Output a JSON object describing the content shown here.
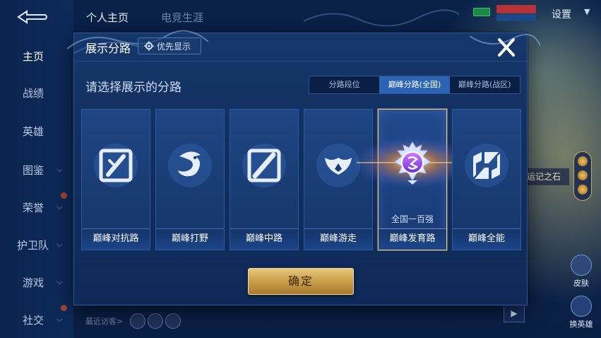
{
  "header": {
    "tabs": [
      {
        "label": "个人主页",
        "active": true
      },
      {
        "label": "电竞生涯",
        "active": false
      }
    ],
    "settings_label": "设置"
  },
  "left_nav": {
    "items": [
      {
        "label": "主页",
        "active": true,
        "has_chevron": false
      },
      {
        "label": "战绩",
        "active": false,
        "has_chevron": false
      },
      {
        "label": "英雄",
        "active": false,
        "has_chevron": false
      },
      {
        "label": "图鉴",
        "active": false,
        "has_chevron": true
      },
      {
        "label": "荣誉",
        "active": false,
        "has_chevron": true
      },
      {
        "label": "护卫队",
        "active": false,
        "has_chevron": true
      },
      {
        "label": "游戏",
        "active": false,
        "has_chevron": true
      },
      {
        "label": "社交",
        "active": false,
        "has_chevron": true
      }
    ]
  },
  "background": {
    "side_tag": "运记之石",
    "side_buttons": [
      "皮肤",
      "换英雄"
    ],
    "visitor_label": "最近访客>"
  },
  "modal": {
    "title": "展示分路",
    "priority_chip": "优先显示",
    "prompt": "请选择展示的分路",
    "segments": [
      {
        "label": "分路段位",
        "active": false
      },
      {
        "label": "巅峰分路(全国)",
        "active": true
      },
      {
        "label": "巅峰分路(战区)",
        "active": false
      }
    ],
    "cards": [
      {
        "label": "巅峰对抗路",
        "icon": "clash-lane-icon",
        "selected": false,
        "rank_text": ""
      },
      {
        "label": "巅峰打野",
        "icon": "jungle-dragon-icon",
        "selected": false,
        "rank_text": ""
      },
      {
        "label": "巅峰中路",
        "icon": "mid-lane-icon",
        "selected": false,
        "rank_text": ""
      },
      {
        "label": "巅峰游走",
        "icon": "roam-wings-icon",
        "selected": false,
        "rank_text": ""
      },
      {
        "label": "巅峰发育路",
        "icon": "farm-lane-badge-icon",
        "selected": true,
        "rank_text": "全国一百强"
      },
      {
        "label": "巅峰全能",
        "icon": "all-round-icon",
        "selected": false,
        "rank_text": ""
      }
    ],
    "confirm_label": "确定"
  },
  "colors": {
    "modal_bg": "#153463",
    "accent_blue": "#2b64b4",
    "gold": "#c59a45",
    "selected_border": "#e8c88a"
  }
}
